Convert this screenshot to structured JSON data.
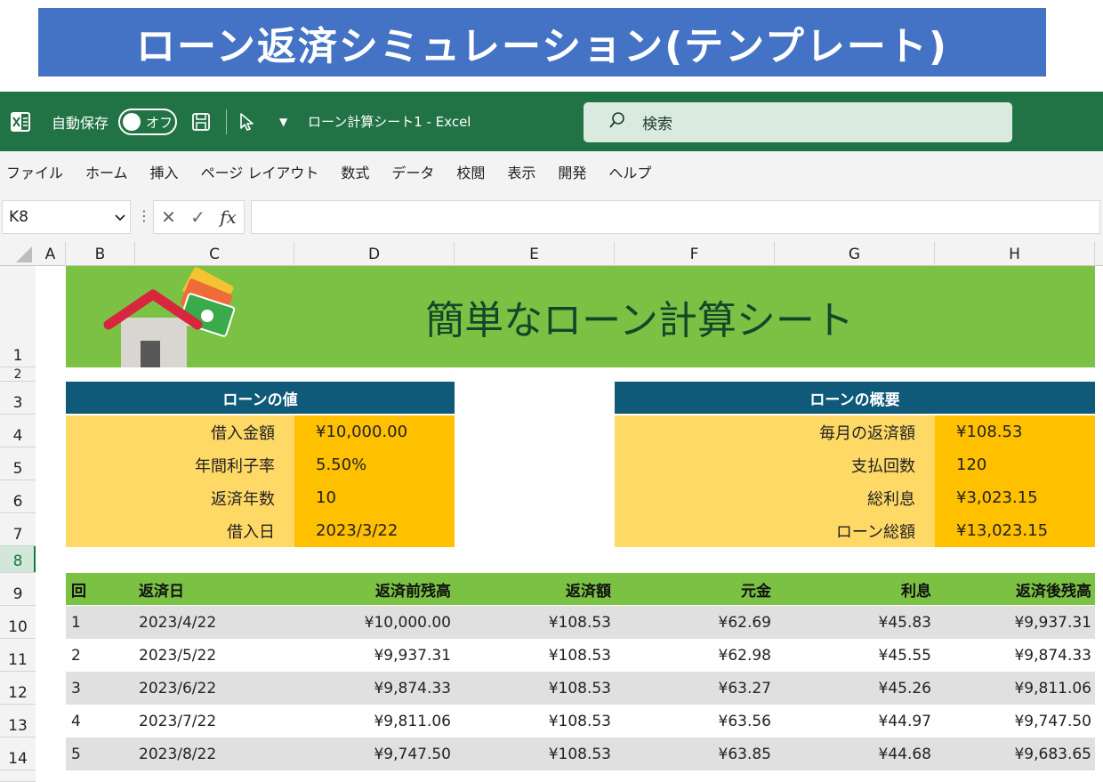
{
  "banner": {
    "title": "ローン返済シミュレーション(テンプレート)"
  },
  "titlebar": {
    "autosave_label": "自動保存",
    "toggle_text": "オフ",
    "doc_title": "ローン計算シート1  -  Excel",
    "search_placeholder": "検索"
  },
  "ribbon": {
    "tabs": [
      "ファイル",
      "ホーム",
      "挿入",
      "ページ レイアウト",
      "数式",
      "データ",
      "校閲",
      "表示",
      "開発",
      "ヘルプ"
    ]
  },
  "formula_bar": {
    "name_box": "K8",
    "formula": ""
  },
  "columns": [
    "A",
    "B",
    "C",
    "D",
    "E",
    "F",
    "G",
    "H"
  ],
  "rows": [
    "1",
    "2",
    "3",
    "4",
    "5",
    "6",
    "7",
    "8",
    "9",
    "10",
    "11",
    "12",
    "13",
    "14"
  ],
  "active_row": "8",
  "sheet": {
    "header_title": "簡単なローン計算シート",
    "loan_values": {
      "title": "ローンの値",
      "items": [
        {
          "label": "借入金額",
          "value": "¥10,000.00"
        },
        {
          "label": "年間利子率",
          "value": "5.50%"
        },
        {
          "label": "返済年数",
          "value": "10"
        },
        {
          "label": "借入日",
          "value": "2023/3/22"
        }
      ]
    },
    "loan_summary": {
      "title": "ローンの概要",
      "items": [
        {
          "label": "毎月の返済額",
          "value": "¥108.53"
        },
        {
          "label": "支払回数",
          "value": "120"
        },
        {
          "label": "総利息",
          "value": "¥3,023.15"
        },
        {
          "label": "ローン総額",
          "value": "¥13,023.15"
        }
      ]
    },
    "schedule": {
      "headers": [
        "回",
        "返済日",
        "返済前残高",
        "返済額",
        "元金",
        "利息",
        "返済後残高"
      ],
      "rows": [
        [
          "1",
          "2023/4/22",
          "¥10,000.00",
          "¥108.53",
          "¥62.69",
          "¥45.83",
          "¥9,937.31"
        ],
        [
          "2",
          "2023/5/22",
          "¥9,937.31",
          "¥108.53",
          "¥62.98",
          "¥45.55",
          "¥9,874.33"
        ],
        [
          "3",
          "2023/6/22",
          "¥9,874.33",
          "¥108.53",
          "¥63.27",
          "¥45.26",
          "¥9,811.06"
        ],
        [
          "4",
          "2023/7/22",
          "¥9,811.06",
          "¥108.53",
          "¥63.56",
          "¥44.97",
          "¥9,747.50"
        ],
        [
          "5",
          "2023/8/22",
          "¥9,747.50",
          "¥108.53",
          "¥63.85",
          "¥44.68",
          "¥9,683.65"
        ]
      ]
    }
  },
  "colors": {
    "banner": "#4472c4",
    "excel_green": "#217346",
    "sheet_green": "#7bc144",
    "panel_blue": "#0f5a79",
    "label_yellow": "#ffd966",
    "value_orange": "#ffc000",
    "row_shade": "#e0e0e0"
  },
  "icons": [
    "excel-icon",
    "save-icon",
    "pointer-icon",
    "chevron-down-icon",
    "search-icon",
    "cancel-icon",
    "check-icon",
    "function-icon",
    "house-icon",
    "money-icon"
  ]
}
